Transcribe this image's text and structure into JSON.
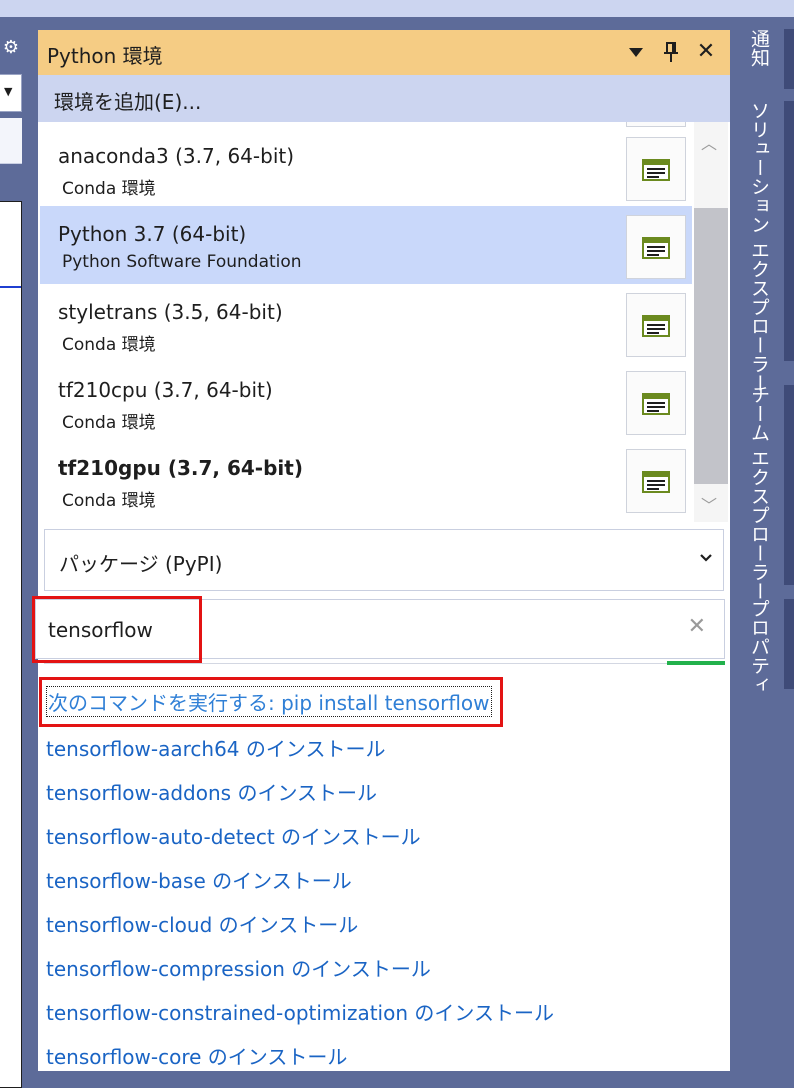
{
  "window": {
    "title": "Python 環境",
    "close_glyph": "✕",
    "pin_glyph": "📌"
  },
  "toolbar": {
    "add_environment": "環境を追加(E)..."
  },
  "environments": [
    {
      "name": "anaconda3 (3.7, 64-bit)",
      "subtitle": "Conda 環境",
      "selected": false,
      "bold": false
    },
    {
      "name": "Python 3.7 (64-bit)",
      "subtitle": "Python Software Foundation",
      "selected": true,
      "bold": false
    },
    {
      "name": "styletrans (3.5, 64-bit)",
      "subtitle": "Conda 環境",
      "selected": false,
      "bold": false
    },
    {
      "name": "tf210cpu (3.7, 64-bit)",
      "subtitle": "Conda 環境",
      "selected": false,
      "bold": false
    },
    {
      "name": "tf210gpu (3.7, 64-bit)",
      "subtitle": "Conda 環境",
      "selected": false,
      "bold": true
    }
  ],
  "package_source": {
    "selected": "パッケージ (PyPI)"
  },
  "search": {
    "value": "tensorflow",
    "clear_glyph": "✕"
  },
  "results": {
    "command": "次のコマンドを実行する: pip install tensorflow",
    "items": [
      "tensorflow-aarch64 のインストール",
      "tensorflow-addons のインストール",
      "tensorflow-auto-detect のインストール",
      "tensorflow-base のインストール",
      "tensorflow-cloud のインストール",
      "tensorflow-compression のインストール",
      "tensorflow-constrained-optimization のインストール",
      "tensorflow-core のインストール"
    ]
  },
  "side_tabs": [
    "通知",
    "ソリューション エクスプローラー",
    "チーム エクスプローラー",
    "プロパティ"
  ],
  "colors": {
    "title_bar": "#f5cc84",
    "toolbar": "#ccd5f0",
    "selection": "#c9d8fa",
    "frame": "#5d6b99",
    "link": "#1a64c4",
    "highlight_box": "#e31313",
    "progress": "#22b14c"
  },
  "icons": {
    "title_dropdown": "dropdown-triangle-icon",
    "title_pin": "pin-icon",
    "title_close": "close-icon",
    "env_action": "environment-overview-icon",
    "search_clear": "clear-search-icon",
    "settings": "gear-icon"
  }
}
